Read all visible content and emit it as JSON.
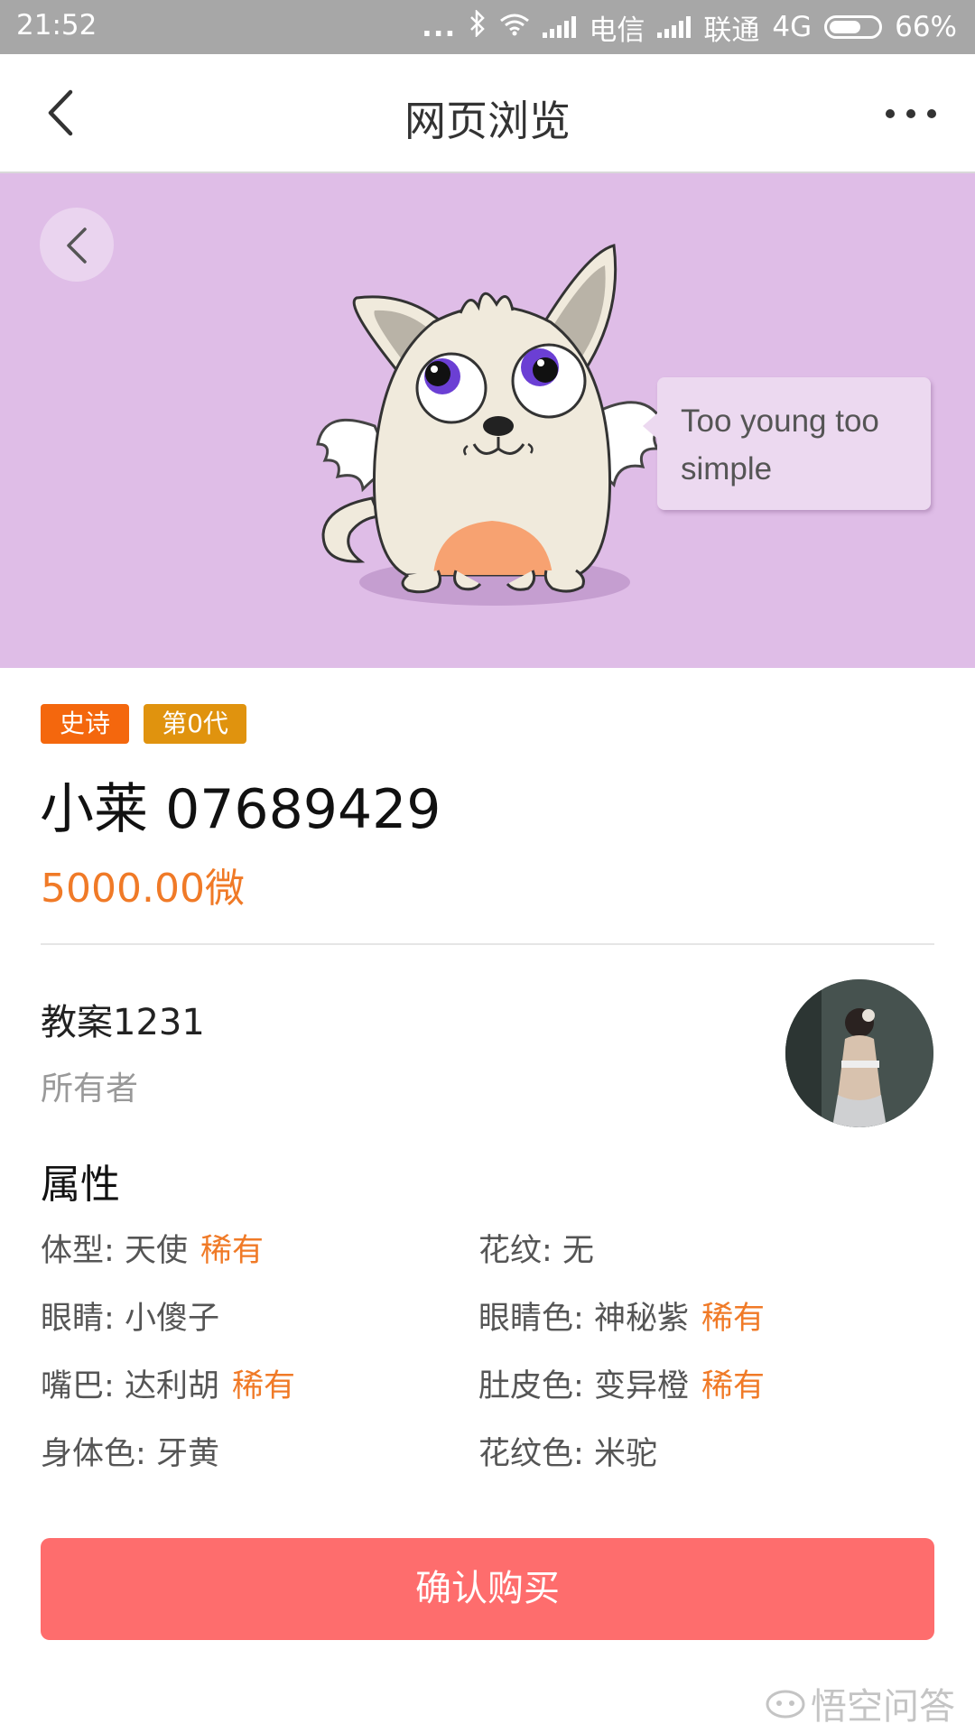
{
  "status_bar": {
    "time": "21:52",
    "dots": "...",
    "carrier1": "电信",
    "carrier2": "联通",
    "network": "4G",
    "battery": "66%",
    "battery_level": 0.66
  },
  "nav": {
    "title": "网页浏览",
    "back_icon": "chevron-left-icon",
    "more_icon": "more-horizontal-icon"
  },
  "hero": {
    "background_color": "#dfbde7",
    "speech_bubble": "Too young too simple",
    "back_icon": "chevron-left-icon"
  },
  "tags": [
    {
      "label": "史诗",
      "color": "#f4670d"
    },
    {
      "label": "第0代",
      "color": "#e0930e"
    }
  ],
  "cat": {
    "name": "小莱 07689429",
    "price": "5000.00微"
  },
  "owner": {
    "name": "教案1231",
    "label": "所有者"
  },
  "attributes": {
    "title": "属性",
    "items": [
      {
        "label": "体型",
        "value": "天使",
        "rare": "稀有"
      },
      {
        "label": "花纹",
        "value": "无",
        "rare": ""
      },
      {
        "label": "眼睛",
        "value": "小傻子",
        "rare": ""
      },
      {
        "label": "眼睛色",
        "value": "神秘紫",
        "rare": "稀有"
      },
      {
        "label": "嘴巴",
        "value": "达利胡",
        "rare": "稀有"
      },
      {
        "label": "肚皮色",
        "value": "变异橙",
        "rare": "稀有"
      },
      {
        "label": "身体色",
        "value": "牙黄",
        "rare": ""
      },
      {
        "label": "花纹色",
        "value": "米驼",
        "rare": ""
      }
    ]
  },
  "buy_button": {
    "label": "确认购买",
    "color": "#fe6d6d"
  },
  "watermark": "悟空问答",
  "colors": {
    "accent_orange": "#f07a27",
    "status_bar": "#a7a7a7"
  }
}
